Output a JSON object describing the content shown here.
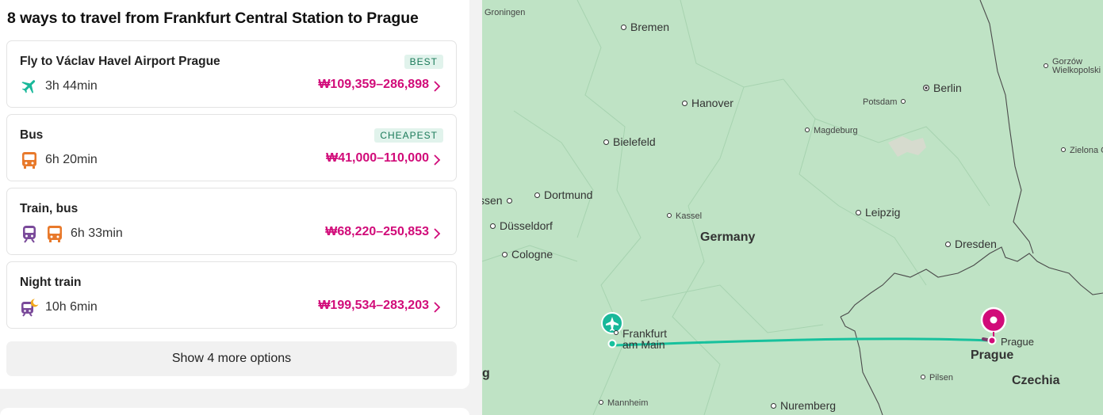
{
  "header": {
    "title": "8 ways to travel from Frankfurt Central Station to Prague"
  },
  "options": [
    {
      "name": "Fly to Václav Havel Airport Prague",
      "badge": "BEST",
      "duration": "3h 44min",
      "price": "₩109,359–286,898",
      "icons": [
        "plane-icon"
      ]
    },
    {
      "name": "Bus",
      "badge": "CHEAPEST",
      "duration": "6h 20min",
      "price": "₩41,000–110,000",
      "icons": [
        "bus-icon"
      ]
    },
    {
      "name": "Train, bus",
      "badge": "",
      "duration": "6h 33min",
      "price": "₩68,220–250,853",
      "icons": [
        "train-icon",
        "bus-icon"
      ]
    },
    {
      "name": "Night train",
      "badge": "",
      "duration": "10h 6min",
      "price": "₩199,534–283,203",
      "icons": [
        "night-train-icon"
      ]
    }
  ],
  "more_button": {
    "label": "Show 4 more options"
  },
  "colors": {
    "accent": "#d10b79",
    "plane": "#19b89a",
    "bus": "#e8792b",
    "train": "#7a4a9a",
    "badge_bg": "#e1f3ec",
    "badge_text": "#1b7a59",
    "map_bg": "#bfe3c5",
    "route": "#17c19d"
  },
  "map": {
    "cities": {
      "groningen": "Groningen",
      "bremen": "Bremen",
      "berlin": "Berlin",
      "gorzow": "Gorzów\nWielkopolski",
      "hanover": "Hanover",
      "potsdam": "Potsdam",
      "magdeburg": "Magdeburg",
      "bielefeld": "Bielefeld",
      "zielona": "Zielona G",
      "dortmund": "Dortmund",
      "essen": "ssen",
      "kassel": "Kassel",
      "leipzig": "Leipzig",
      "dusseldorf": "Düsseldorf",
      "dresden": "Dresden",
      "cologne": "Cologne",
      "frankfurt": "Frankfurt\nam Main",
      "prague_small": "Prague",
      "prague": "Prague",
      "pilsen": "Pilsen",
      "mannheim": "Mannheim",
      "nuremberg": "Nuremberg",
      "g_cut": "g"
    },
    "countries": {
      "germany": "Germany",
      "czechia": "Czechia"
    }
  }
}
